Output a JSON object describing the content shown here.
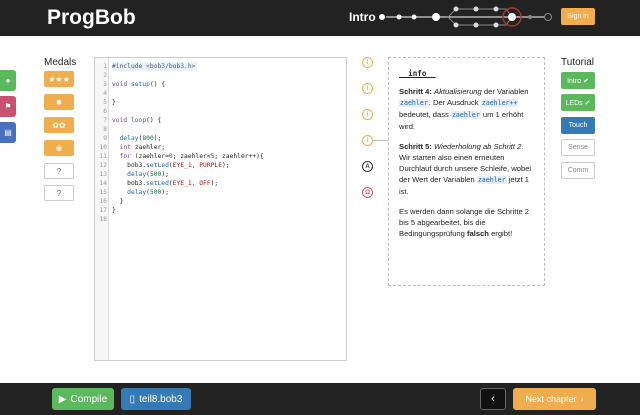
{
  "header": {
    "brand": "ProgBob",
    "progress_label": "Intro",
    "signin_label": "Sign in"
  },
  "medals": {
    "title": "Medals",
    "items": [
      "★★★",
      "✸",
      "✿✿",
      "❀",
      "?",
      "?"
    ]
  },
  "editor": {
    "lines": [
      {
        "n": "1",
        "html": "<span class=\"pp\">#include &lt;bob3/bob3.h&gt;</span>"
      },
      {
        "n": "2",
        "html": ""
      },
      {
        "n": "3",
        "html": "<span class=\"kw\">void</span> <span class=\"fn\">setup</span>() {"
      },
      {
        "n": "4",
        "html": ""
      },
      {
        "n": "5",
        "html": "}"
      },
      {
        "n": "6",
        "html": ""
      },
      {
        "n": "7",
        "html": "<span class=\"kw\">void</span> <span class=\"fn\">loop</span>() {"
      },
      {
        "n": "8",
        "html": ""
      },
      {
        "n": "9",
        "html": "  <span class=\"fn\">delay</span>(<span class=\"num\">800</span>);"
      },
      {
        "n": "10",
        "html": "  <span class=\"kw\">int</span> zaehler;"
      },
      {
        "n": "11",
        "html": "  <span class=\"kw\">for</span> (zaehler=<span class=\"num\">0</span>; zaehler&lt;<span class=\"num\">5</span>; zaehler++){"
      },
      {
        "n": "12",
        "html": "    bob3.<span class=\"fn\">setLed</span>(<span class=\"cst\">EYE_1</span>, <span class=\"cst\">PURPLE</span>);"
      },
      {
        "n": "13",
        "html": "    <span class=\"fn\">delay</span>(<span class=\"num\">500</span>);"
      },
      {
        "n": "14",
        "html": "    bob3.<span class=\"fn\">setLed</span>(<span class=\"cst\">EYE_1</span>, <span class=\"cst\">OFF</span>);"
      },
      {
        "n": "15",
        "html": "    <span class=\"fn\">delay</span>(<span class=\"num\">500</span>);"
      },
      {
        "n": "16",
        "html": "  }"
      },
      {
        "n": "17",
        "html": "}"
      },
      {
        "n": "18",
        "html": ""
      }
    ]
  },
  "markers": [
    "i",
    "i",
    "i",
    "i",
    "A",
    "Ω"
  ],
  "info": {
    "title": "__info__",
    "p1_lead": "Schritt 4:",
    "p1_italic": "Aktualisierung",
    "p1_a": "der Variablen",
    "p1_code1": "zaehler",
    "p1_b": ". Der Ausdruck",
    "p1_code2": "zaehler++",
    "p1_c": "bedeutet, dass",
    "p1_code3": "zaehler",
    "p1_d": "um 1 erhöht wird.",
    "p2_lead": "Schritt 5:",
    "p2_italic": "Wiederholung ab Schritt 2",
    "p2_a": ". Wir starten also einen erneuten Durchlauf durch unsere Schleife, wobei der Wert der Variablen",
    "p2_code": "zaehler",
    "p2_b": "jetzt 1 ist.",
    "p3_a": "Es werden dann solange die Schritte 2 bis 5 abgearbeitet, bis die Bedingungsprüfung",
    "p3_bold": "falsch",
    "p3_b": "ergibt!"
  },
  "tutorial": {
    "title": "Tutorial",
    "items": [
      {
        "label": "Intro ✔",
        "style": "green"
      },
      {
        "label": "LEDs ✔",
        "style": "green"
      },
      {
        "label": "Touch",
        "style": "blue"
      },
      {
        "label": "Sense",
        "style": "gray"
      },
      {
        "label": "Comm",
        "style": "gray"
      }
    ]
  },
  "footer": {
    "compile_label": "Compile",
    "file_label": "teil8.bob3",
    "prev_label": "‹",
    "next_label": "Next chapter"
  },
  "colors": {
    "header_bg": "#222222",
    "orange": "#f0ad4e",
    "green": "#5cb85c",
    "blue": "#337ab7",
    "red_tab": "#c9506f",
    "sidetab_green": "#5cb85c",
    "sidetab_blue": "#4a6fbf"
  }
}
